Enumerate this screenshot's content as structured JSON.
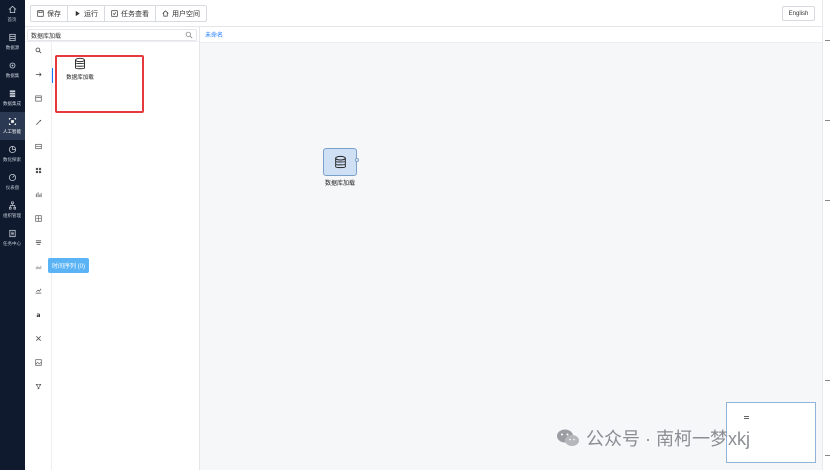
{
  "nav": {
    "items": [
      {
        "label": "首页",
        "icon": "home-icon"
      },
      {
        "label": "数据源",
        "icon": "database-icon"
      },
      {
        "label": "数据集",
        "icon": "gear-icon"
      },
      {
        "label": "数据集成",
        "icon": "stack-icon"
      },
      {
        "label": "人工智能",
        "icon": "ai-icon",
        "active": true
      },
      {
        "label": "数化探索",
        "icon": "pie-icon"
      },
      {
        "label": "仪表盘",
        "icon": "gauge-icon"
      },
      {
        "label": "组织管理",
        "icon": "org-icon"
      },
      {
        "label": "任务中心",
        "icon": "list-icon"
      }
    ]
  },
  "toolbar": {
    "save": "保存",
    "run": "运行",
    "tasks": "任务查看",
    "user_space": "用户空间",
    "language": "English"
  },
  "panel": {
    "search_value": "数据库加载",
    "component_label": "数据库加载",
    "tooltip": "时间序列 (0)"
  },
  "canvas": {
    "tab_label": "未命名",
    "node_label": "数据库加载"
  },
  "watermark": "公众号 · 南柯一梦xkj",
  "colors": {
    "nav_bg": "#0f1a2e",
    "accent": "#1677ff",
    "highlight": "#e5393e",
    "tooltip_bg": "#5ab3f5",
    "node_fill": "#cfe0f5"
  }
}
